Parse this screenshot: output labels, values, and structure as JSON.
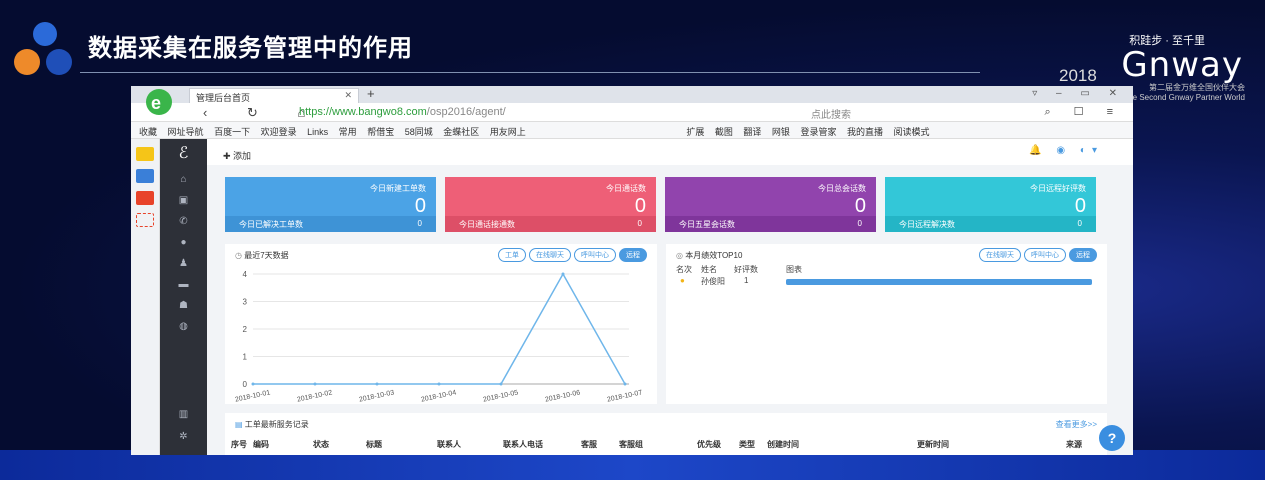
{
  "slide": {
    "title": "数据采集在服务管理中的作用",
    "brand_top": "积跬步 · 至千里",
    "brand_name": "Gnway",
    "brand_year": "2018",
    "brand_sub": "第二届金万维全国伙伴大会",
    "brand_sub_en": "The Second Gnway Partner World"
  },
  "browser": {
    "tab_title": "管理后台首页",
    "url_prefix": "https://www.bangwo8.com",
    "url_path": "/osp2016/agent/",
    "search_placeholder": "点此搜索",
    "bookmarks": [
      "收藏",
      "网址导航",
      "百度一下",
      "欢迎登录",
      "Links",
      "常用",
      "帮借宝",
      "58同城",
      "金蝶社区",
      "用友网上",
      "扩展",
      "截图",
      "翻译",
      "网银",
      "登录管家",
      "我的直播",
      "阅读模式"
    ]
  },
  "app": {
    "add_label": "添加",
    "cards": [
      {
        "label": "今日新建工单数",
        "value": "0",
        "foot_label": "今日已解决工单数",
        "foot_value": "0",
        "color": "#4ba3e6",
        "foot_color": "#3e93d6"
      },
      {
        "label": "今日通话数",
        "value": "0",
        "foot_label": "今日通话接通数",
        "foot_value": "0",
        "color": "#ee5f77",
        "foot_color": "#dd4f67"
      },
      {
        "label": "今日总会话数",
        "value": "0",
        "foot_label": "今日五星会话数",
        "foot_value": "0",
        "color": "#9144ad",
        "foot_color": "#7f359b"
      },
      {
        "label": "今日远程好评数",
        "value": "0",
        "foot_label": "今日远程解决数",
        "foot_value": "0",
        "color": "#33c7d8",
        "foot_color": "#24b5c6"
      }
    ],
    "stats_panel": {
      "title": "最近7天数据",
      "pills": [
        "工单",
        "在线聊天",
        "呼叫中心",
        "远程"
      ],
      "active_pill": 3
    },
    "top10_panel": {
      "title": "本月绩效TOP10",
      "pills": [
        "在线聊天",
        "呼叫中心",
        "远程"
      ],
      "active_pill": 2,
      "headers": [
        "名次",
        "姓名",
        "好评数",
        "图表"
      ],
      "rows": [
        {
          "name": "孙俊阳",
          "count": "1",
          "share": 1.0
        }
      ]
    },
    "records_panel": {
      "title": "工单最新服务记录",
      "more": "查看更多>>",
      "headers": [
        "序号",
        "编码",
        "状态",
        "标题",
        "联系人",
        "联系人电话",
        "客服",
        "客服组",
        "优先级",
        "类型",
        "创建时间",
        "更新时间",
        "来源"
      ]
    },
    "help_label": "?"
  },
  "chart_data": {
    "type": "line",
    "x": [
      "2018-10-01",
      "2018-10-02",
      "2018-10-03",
      "2018-10-04",
      "2018-10-05",
      "2018-10-06",
      "2018-10-07"
    ],
    "series": [
      {
        "values": [
          0,
          0,
          0,
          0,
          0,
          4,
          0
        ],
        "color": "#6fb6ea"
      }
    ],
    "ylim": [
      0,
      4
    ],
    "yticks": [
      "0",
      "1",
      "2",
      "3",
      "4"
    ],
    "grid": true
  }
}
